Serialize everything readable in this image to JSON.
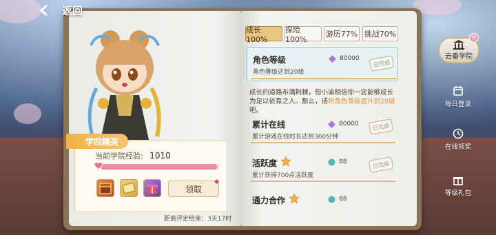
{
  "header": {
    "back_label": "返回"
  },
  "tabs": [
    {
      "label": "成长100%",
      "active": true
    },
    {
      "label": "探险100%",
      "active": false
    },
    {
      "label": "游历77%",
      "active": false
    },
    {
      "label": "挑战70%",
      "active": false
    }
  ],
  "profile": {
    "rank": "学院精英",
    "exp_label": "当前学院经验:",
    "exp_value": "1010",
    "exp_progress": 0.98,
    "claim_label": "领取",
    "timer": "距离评定结束：3天17时"
  },
  "tasks": [
    {
      "title": "角色等级",
      "desc": "角色等级达到20级",
      "reward": "80000",
      "stamp": "已完成",
      "highlight": true
    },
    {
      "title": "累计在线",
      "desc": "累计游戏在线时长达到360分钟",
      "reward": "80000",
      "stamp": "已完成",
      "highlight": false
    },
    {
      "title": "活跃度",
      "desc": "累计获得700点活跃度",
      "reward": "88",
      "stamp": "已完成",
      "highlight": false
    },
    {
      "title": "通力合作",
      "desc": "",
      "reward": "88",
      "stamp": "",
      "highlight": false
    }
  ],
  "description": {
    "part1": "成长的道路布满荆棘，但小谕相信你一定能够成长为足以依靠之人。那么，请",
    "highlight": "将角色等级提升到20级",
    "part2": "吧。"
  },
  "sidebar": {
    "academy": "云垂学院",
    "items": [
      {
        "label": "每日登录",
        "icon": "calendar-icon"
      },
      {
        "label": "在线领奖",
        "icon": "clock-icon"
      },
      {
        "label": "等级礼包",
        "icon": "gift-icon"
      }
    ]
  },
  "colors": {
    "accent": "#e9c582",
    "highlight_text": "#e39335",
    "exp_fill": "#ee8aa4"
  }
}
